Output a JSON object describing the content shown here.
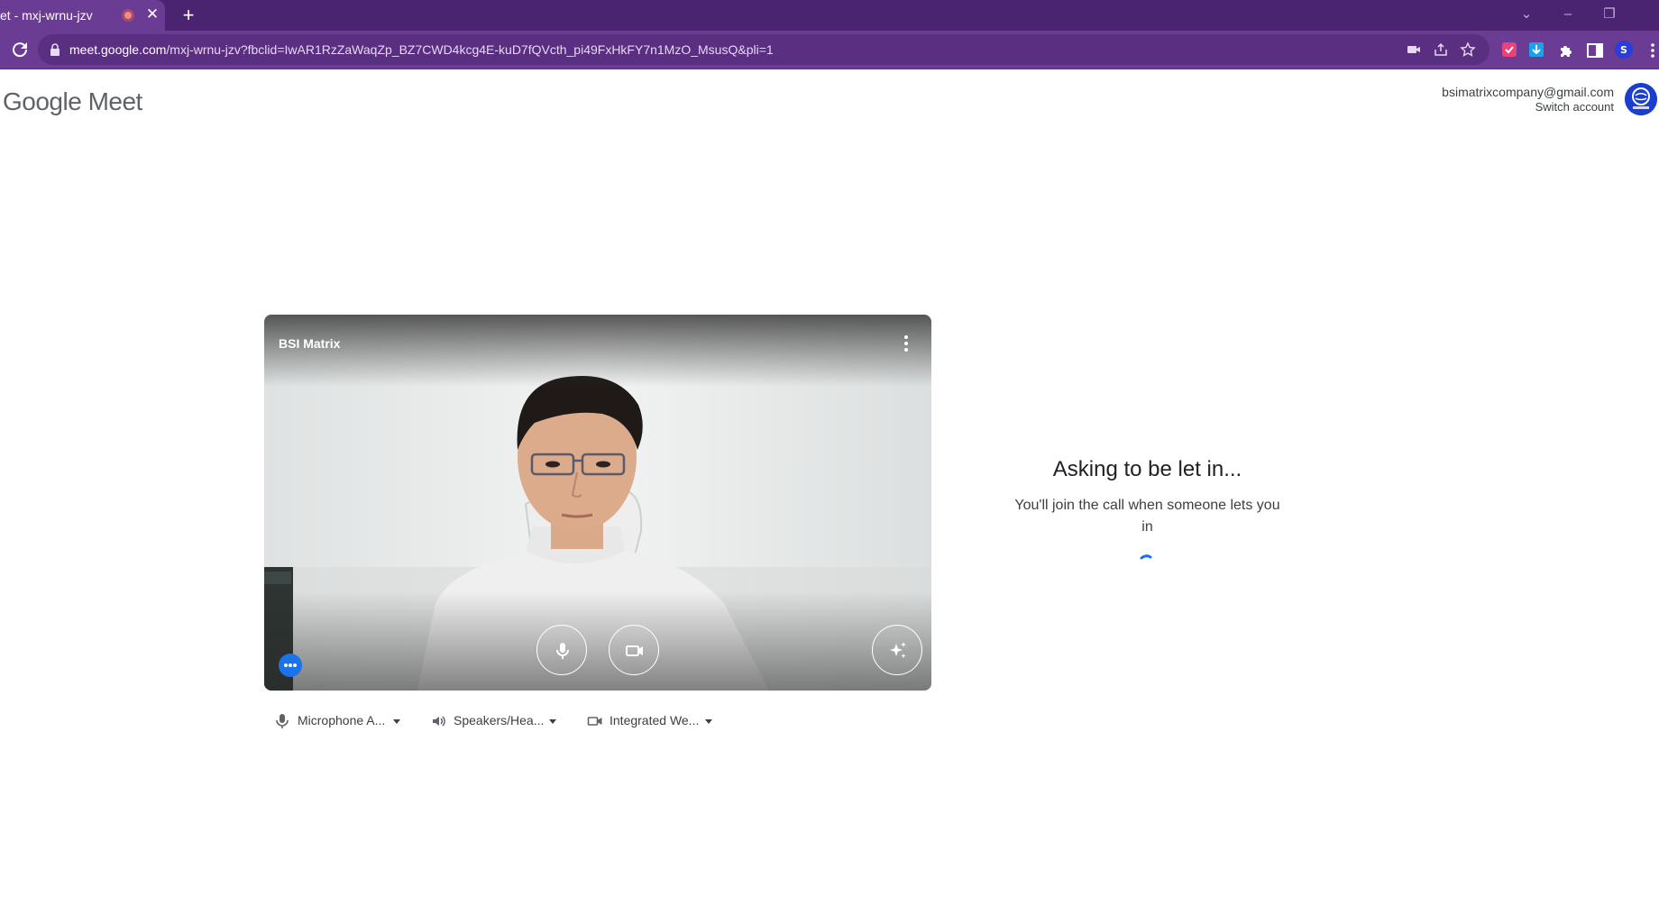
{
  "browser": {
    "tab_title": "et - mxj-wrnu-jzv",
    "url_host": "meet.google.com",
    "url_path": "/mxj-wrnu-jzv?fbclid=IwAR1RzZaWaqZp_BZ7CWD4kcg4E-kuD7fQVcth_pi49FxHkFY7n1MzO_MsusQ&pli=1",
    "icons": [
      "reload-icon",
      "lock-icon",
      "camera-icon",
      "share-icon",
      "star-icon",
      "extension-red-icon",
      "download-icon",
      "puzzle-icon",
      "side-panel-icon",
      "profile-icon",
      "menu-icon"
    ]
  },
  "header": {
    "logo_text": "Google Meet",
    "account_email": "bsimatrixcompany@gmail.com",
    "switch_account": "Switch account"
  },
  "preview": {
    "participant_name": "BSI Matrix"
  },
  "devices": {
    "microphone": "Microphone A...",
    "speakers": "Speakers/Hea...",
    "camera": "Integrated We..."
  },
  "status": {
    "title": "Asking to be let in...",
    "subtitle": "You'll join the call when someone lets you in"
  },
  "colors": {
    "chrome_dark": "#4a2470",
    "chrome": "#6b3c93",
    "accent": "#1a73e8"
  }
}
